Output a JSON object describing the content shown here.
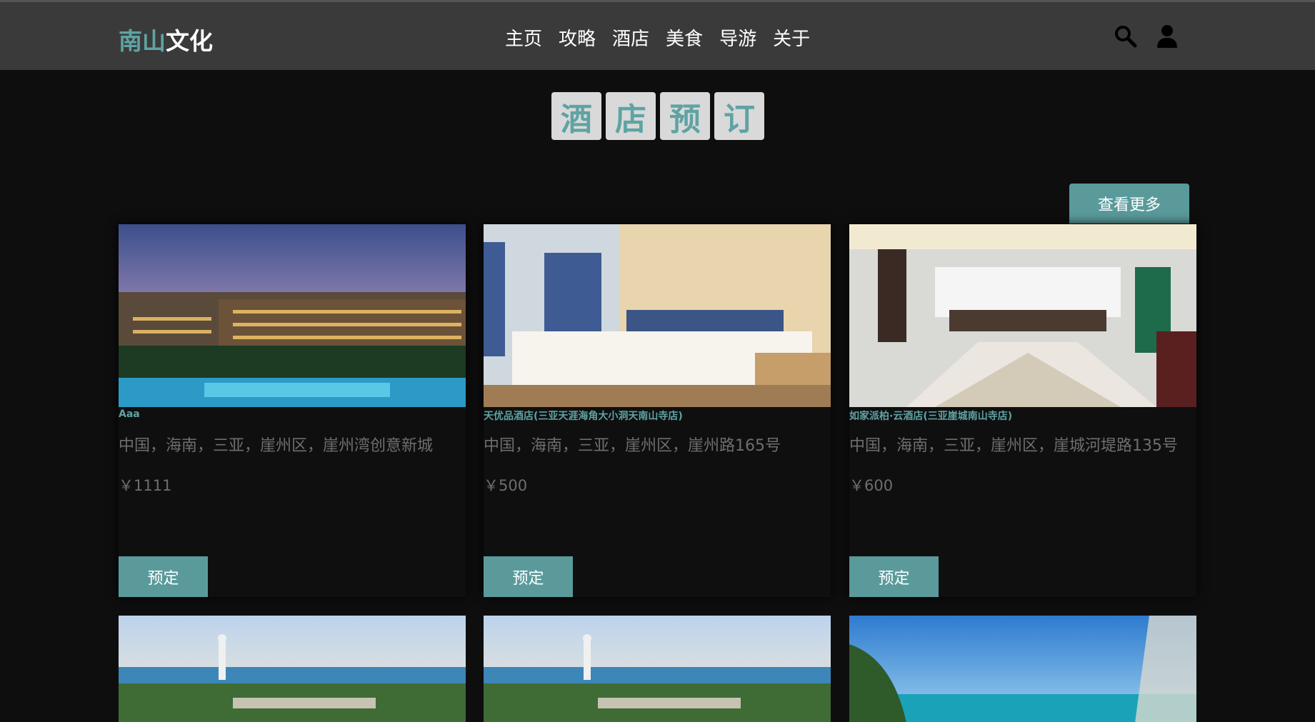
{
  "brand": {
    "part1": "南山",
    "part2": "文化"
  },
  "nav": [
    "主页",
    "攻略",
    "酒店",
    "美食",
    "导游",
    "关于"
  ],
  "icons": {
    "search": "search-icon",
    "user": "user-icon"
  },
  "heading": [
    "酒",
    "店",
    "预",
    "订"
  ],
  "more_label": "查看更多",
  "hotels": [
    {
      "name": "Aaa",
      "address": "中国，海南，三亚，崖州区，崖州湾创意新城",
      "price": "￥1111",
      "book": "预定"
    },
    {
      "name": "天优品酒店(三亚天涯海角大小洞天南山寺店)",
      "address": "中国，海南，三亚，崖州区，崖州路165号",
      "price": "￥500",
      "book": "预定"
    },
    {
      "name": "如家派柏·云酒店(三亚崖城南山寺店)",
      "address": "中国，海南，三亚，崖州区，崖城河堤路135号",
      "price": "￥600",
      "book": "预定"
    }
  ],
  "colors": {
    "accent": "#5fa3a3",
    "button": "#5a9a9b",
    "topbar": "#3a3a3a",
    "background": "#0e0e0f"
  }
}
